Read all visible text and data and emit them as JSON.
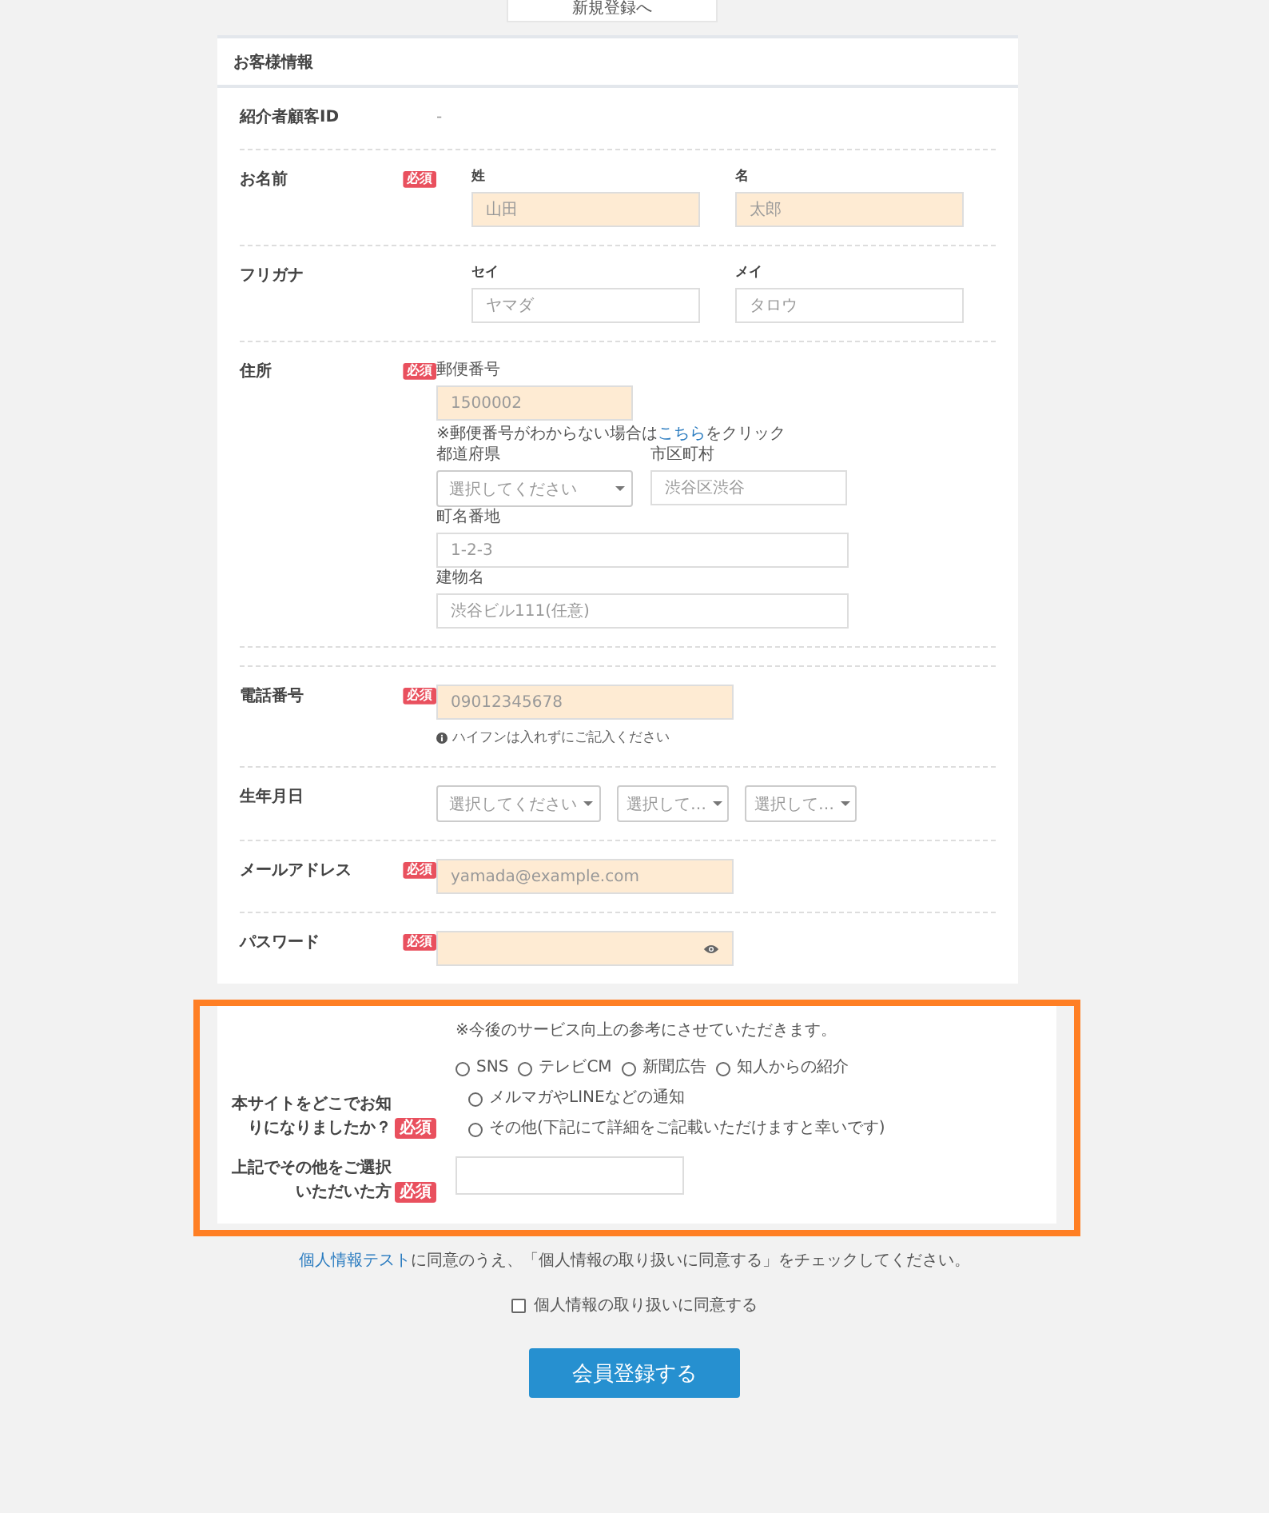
{
  "top_tab": {
    "label": "新規登録へ"
  },
  "section_title": "お客様情報",
  "rows": [
    {
      "kind": "static",
      "label": "紹介者顧客ID",
      "value": "-"
    },
    {
      "kind": "pair",
      "label": "お名前",
      "badge": "必須",
      "fields": [
        {
          "caption": "姓",
          "placeholder": "山田",
          "highlighted": true
        },
        {
          "caption": "名",
          "placeholder": "太郎",
          "highlighted": true
        }
      ]
    },
    {
      "kind": "pair",
      "label": "フリガナ",
      "fields": [
        {
          "caption": "セイ",
          "placeholder": "ヤマダ",
          "highlighted": false
        },
        {
          "caption": "メイ",
          "placeholder": "タロウ",
          "highlighted": false
        }
      ]
    },
    {
      "kind": "address",
      "label": "住所",
      "badge": "必須",
      "postal": {
        "caption": "郵便番号",
        "placeholder": "1500002",
        "highlighted": true
      },
      "note": {
        "before": "※郵便番号がわからない場合は",
        "link": "こちら",
        "after": "をクリック"
      },
      "prefecture": {
        "caption": "都道府県",
        "placeholder": "選択してください"
      },
      "city": {
        "caption": "市区町村",
        "placeholder": "渋谷区渋谷",
        "highlighted": false
      },
      "street": {
        "caption": "町名番地",
        "placeholder": "1-2-3",
        "highlighted": false
      },
      "building": {
        "caption": "建物名",
        "placeholder": "渋谷ビル111(任意)",
        "highlighted": false
      }
    },
    {
      "kind": "phone",
      "label": "電話番号",
      "badge": "必須",
      "field": {
        "placeholder": "09012345678",
        "highlighted": true
      },
      "hint": "ハイフンは入れずにご記入ください"
    },
    {
      "kind": "date",
      "label": "生年月日",
      "selects": [
        "選択してください",
        "選択して…",
        "選択して…"
      ]
    },
    {
      "kind": "email",
      "label": "メールアドレス",
      "badge": "必須",
      "field": {
        "placeholder": "yamada@example.com",
        "highlighted": true
      }
    },
    {
      "kind": "password",
      "label": "パスワード",
      "badge": "必須",
      "field": {
        "highlighted": true
      }
    }
  ],
  "survey": {
    "label": "本サイトをどこでお知りになりましたか？",
    "badge": "必須",
    "note": "※今後のサービス向上の参考にさせていただきます。",
    "options": [
      {
        "label": "SNS",
        "selected": false
      },
      {
        "label": "テレビCM",
        "selected": false
      },
      {
        "label": "新聞広告",
        "selected": false
      },
      {
        "label": "知人からの紹介",
        "selected": false
      },
      {
        "label": "メルマガやLINEなどの通知",
        "selected": false
      },
      {
        "label": "その他(下記にて詳細をご記載いただけますと幸いです)",
        "selected": false
      }
    ],
    "other": {
      "label": "上記でその他をご選択いただいた方",
      "badge": "必須"
    }
  },
  "consent": {
    "link": "個人情報テスト",
    "text": "に同意のうえ、「個人情報の取り扱いに同意する」をチェックしてください。",
    "checkbox": {
      "label": "個人情報の取り扱いに同意する",
      "checked": false
    }
  },
  "submit": {
    "label": "会員登録する"
  }
}
